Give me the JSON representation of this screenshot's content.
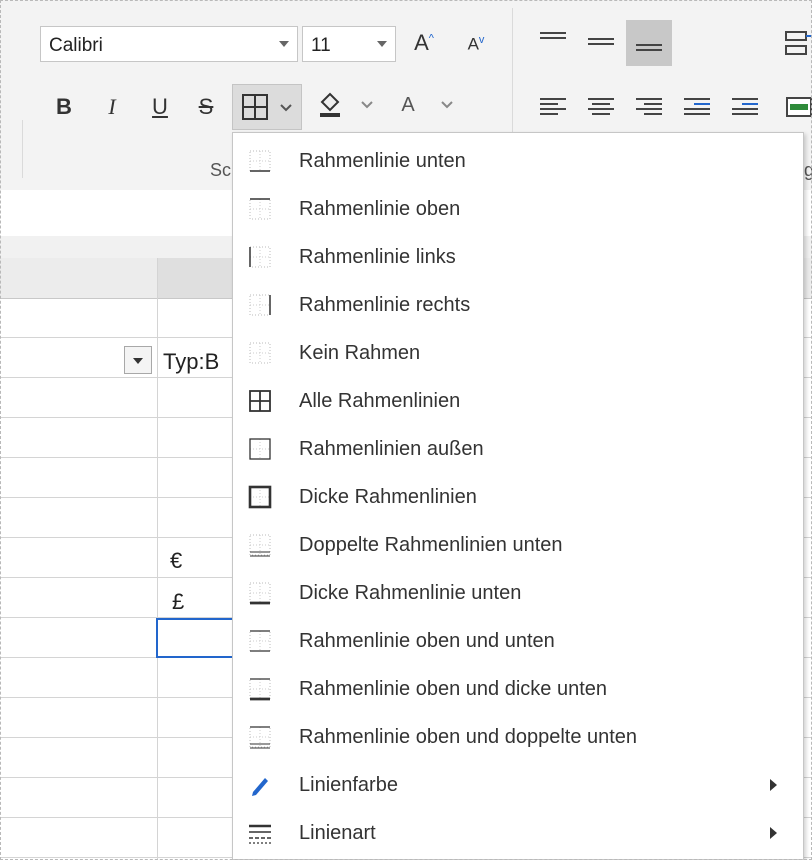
{
  "ribbon": {
    "font_name": "Calibri",
    "font_size": "11",
    "grow_font": "A",
    "shrink_font": "A",
    "bold": "B",
    "italic": "I",
    "underline": "U",
    "strike": "S",
    "font_color": "A",
    "group_label_left": "Sc",
    "group_label_right": "g"
  },
  "sheet": {
    "cell_typ": "Typ:B",
    "cell_euro": "€",
    "cell_pound": "£"
  },
  "border_menu": {
    "items": [
      {
        "label": "Rahmenlinie unten",
        "icon": "border-bottom-icon"
      },
      {
        "label": "Rahmenlinie oben",
        "icon": "border-top-icon"
      },
      {
        "label": "Rahmenlinie links",
        "icon": "border-left-icon"
      },
      {
        "label": "Rahmenlinie rechts",
        "icon": "border-right-icon"
      },
      {
        "label": "Kein Rahmen",
        "icon": "no-border-icon"
      },
      {
        "label": "Alle Rahmenlinien",
        "icon": "all-borders-icon"
      },
      {
        "label": "Rahmenlinien außen",
        "icon": "outside-borders-icon"
      },
      {
        "label": "Dicke Rahmenlinien",
        "icon": "thick-borders-icon"
      },
      {
        "label": "Doppelte Rahmenlinien unten",
        "icon": "double-bottom-border-icon"
      },
      {
        "label": "Dicke Rahmenlinie unten",
        "icon": "thick-bottom-border-icon"
      },
      {
        "label": "Rahmenlinie oben und unten",
        "icon": "top-bottom-border-icon"
      },
      {
        "label": "Rahmenlinie oben und dicke unten",
        "icon": "top-thick-bottom-border-icon"
      },
      {
        "label": "Rahmenlinie oben und doppelte unten",
        "icon": "top-double-bottom-border-icon"
      },
      {
        "label": "Linienfarbe",
        "icon": "pencil-icon",
        "submenu": true
      },
      {
        "label": "Linienart",
        "icon": "line-style-icon",
        "submenu": true
      }
    ]
  },
  "colors": {
    "accent": "#2266cc",
    "selected_tool": "#c8c8c8"
  }
}
